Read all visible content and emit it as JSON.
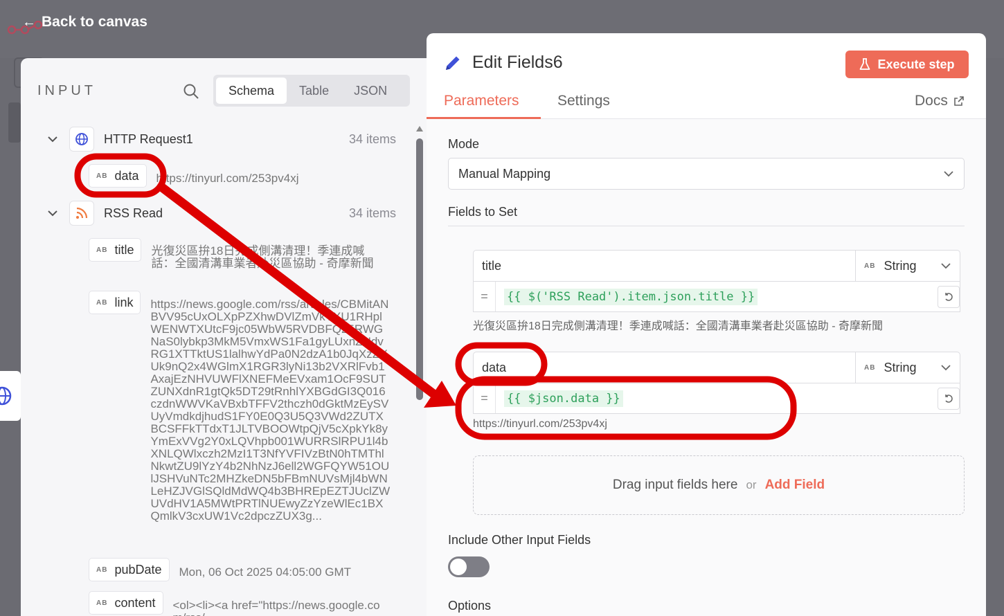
{
  "header": {
    "back_label": "Back to canvas"
  },
  "input_panel": {
    "title": "INPUT",
    "view_tabs": [
      "Schema",
      "Table",
      "JSON"
    ],
    "nodes": [
      {
        "name": "HTTP Request1",
        "count": "34 items",
        "fields": [
          {
            "label": "data",
            "value": "https://tinyurl.com/253pv4xj"
          }
        ]
      },
      {
        "name": "RSS Read",
        "count": "34 items",
        "fields": [
          {
            "label": "title",
            "value": "光復災區拚18日完成側溝清理！季連成喊話：全國清溝車業者赴災區協助 - 奇摩新聞"
          },
          {
            "label": "link",
            "value": "https://news.google.com/rss/articles/CBMitANBVV95cUxOLXpPZXhwDVlZmVkYXU1RHplWENWTXUtcF9jc05WbW5RVDBFQ25RWGNaS0lybkp3MkM5VmxWS1Fa1gyLUxnZHdvRG1XTTktUS1lalhwYdPa0N2dzA1b0JqXzZYUk9nQ2x4WGlmX1RGR3lyNi13b2VXRlFvb1AxajEzNHVUWFlXNEFMeEVxam1OcF9SUTZUNXdnR1gtQk5DT29tRnhlYXBGdGI3Q016czdnWWVKaVBxbTFFV2thczh0dGktMzEySVUyVmdkdjhudS1FY0E0Q3U5Q3VWd2ZUTXBCSFFkTTdxT1JLTVBOOWtpQjV5cXpkYk8yYmExVVg2Y0xLQVhpb001WURRSlRPU1l4bXNLQWlxczh2MzI1T3NfYVFIVzBtN0hTMThlNkwtZU9lYzY4b2NhNzJ6ell2WGFQYW51OUlJSHVuNTc2MHZkeDN5bFBmNUVsMjl4bWNLeHZJVGlSQldMdWQ4b3BHREpEZTJUclZWUVdHV1A5MWtPRTlNUEwyZzYzeWlEc1BXQmlkV3cxUW1Vc2dpczZUX3g..."
          },
          {
            "label": "pubDate",
            "value": "Mon, 06 Oct 2025 04:05:00 GMT"
          },
          {
            "label": "content",
            "value": "<ol><li><a href=\"https://news.google.com/rss/"
          }
        ]
      }
    ]
  },
  "edit_panel": {
    "title": "Edit Fields6",
    "execute_label": "Execute step",
    "tabs": [
      "Parameters",
      "Settings"
    ],
    "docs_label": "Docs",
    "mode_label": "Mode",
    "mode_value": "Manual Mapping",
    "fields_to_set_label": "Fields to Set",
    "assignments": [
      {
        "name": "title",
        "type": "String",
        "expression": "{{ $('RSS Read').item.json.title }}",
        "preview": "光復災區拚18日完成側溝清理！季連成喊話：全國清溝車業者赴災區協助 - 奇摩新聞"
      },
      {
        "name": "data",
        "type": "String",
        "expression": "{{ $json.data }}",
        "preview": "https://tinyurl.com/253pv4xj"
      }
    ],
    "dropzone_text": "Drag input fields here",
    "dropzone_or": "or",
    "add_field_label": "Add Field",
    "include_other_label": "Include Other Input Fields",
    "include_other_enabled": false,
    "options_label": "Options"
  },
  "annotation_color": "#dd0000",
  "accent_color": "#ee6b58"
}
